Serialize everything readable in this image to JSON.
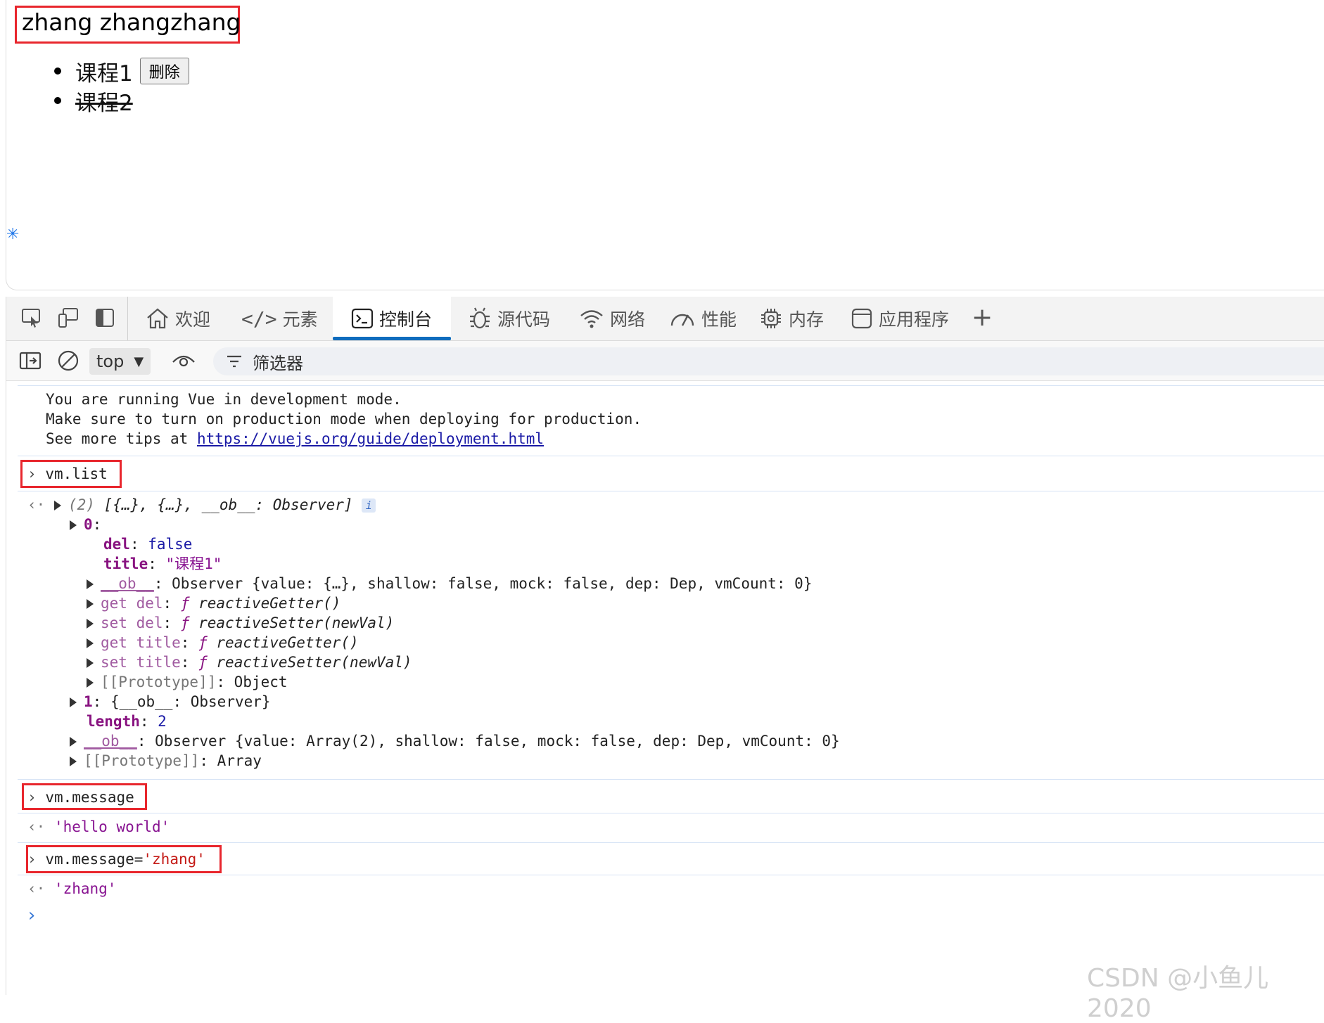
{
  "page": {
    "heading": "zhang zhangzhang",
    "courses": [
      {
        "title": "课程1",
        "delete_label": "删除",
        "done": false
      },
      {
        "title": "课程2",
        "done": true
      }
    ]
  },
  "devtools": {
    "tabs": [
      {
        "label": "欢迎",
        "icon": "home-icon"
      },
      {
        "label": "元素",
        "icon": "code-icon"
      },
      {
        "label": "控制台",
        "icon": "console-icon",
        "active": true
      },
      {
        "label": "源代码",
        "icon": "bug-icon"
      },
      {
        "label": "网络",
        "icon": "wifi-icon"
      },
      {
        "label": "性能",
        "icon": "gauge-icon"
      },
      {
        "label": "内存",
        "icon": "chip-icon"
      },
      {
        "label": "应用程序",
        "icon": "app-icon"
      }
    ],
    "context": "top",
    "filter_label": "筛选器",
    "accent": "#0f6cbd"
  },
  "console": {
    "vue_notice": [
      "You are running Vue in development mode.",
      "Make sure to turn on production mode when deploying for production.",
      "See more tips at "
    ],
    "vue_link": "https://vuejs.org/guide/deployment.html",
    "cmd1": "vm.list",
    "list_summary_count": "(2)",
    "list_summary": "[{…}, {…}, __ob__: Observer]",
    "item0_key": "0",
    "del_key": "del",
    "del_value": "false",
    "title_key": "title",
    "title_value": "\"课程1\"",
    "ob_key": "__ob__",
    "observer0": "Observer {value: {…}, shallow: false, mock: false, dep: Dep, vmCount: 0}",
    "get_del": "get del",
    "set_del": "set del",
    "get_title": "get title",
    "set_title": "set title",
    "getter_fn": "reactiveGetter()",
    "setter_fn": "reactiveSetter(newVal)",
    "proto_key": "[[Prototype]]",
    "proto_object": "Object",
    "item1_key": "1",
    "item1_value": "{__ob__: Observer}",
    "length_key": "length",
    "length_value": "2",
    "observer_list": "Observer {value: Array(2), shallow: false, mock: false, dep: Dep, vmCount: 0}",
    "proto_array": "Array",
    "cmd2": "vm.message",
    "result2": "'hello world'",
    "cmd3_prefix": "vm.message=",
    "cmd3_string": "'zhang'",
    "result3": "'zhang'"
  },
  "watermark": "CSDN @小鱼儿2020",
  "colors": {
    "highlight_box": "#e8262d",
    "console_key": "#881280",
    "console_value": "#1a1aa6"
  }
}
